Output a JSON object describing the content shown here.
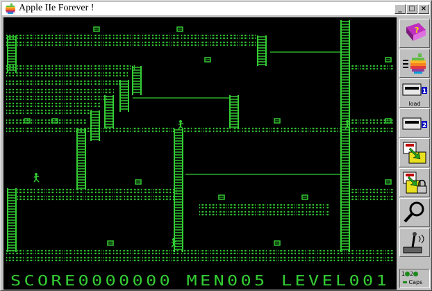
{
  "window": {
    "title": "Apple IIe Forever !",
    "minimize_label": "_",
    "maximize_label": "□",
    "close_label": "×"
  },
  "toolbar": {
    "items": [
      {
        "name": "help-book-icon",
        "label": ""
      },
      {
        "name": "apple-menu-icon",
        "label": ""
      },
      {
        "name": "disk-drive-1-icon",
        "label": "load",
        "badge": "1"
      },
      {
        "name": "disk-drive-2-icon",
        "label": "",
        "badge": "2"
      },
      {
        "name": "save-disk-icon",
        "label": ""
      },
      {
        "name": "lock-disk-icon",
        "label": ""
      },
      {
        "name": "magnifier-icon",
        "label": ""
      },
      {
        "name": "joystick-icon",
        "label": ""
      }
    ]
  },
  "status": {
    "drive1": "1",
    "drive2": "2",
    "caps": "Caps"
  },
  "game": {
    "status_line": "SCORE0000000 MEN005 LEVEL001",
    "phosphor_color": "#33cc33",
    "background_color": "#000000"
  }
}
